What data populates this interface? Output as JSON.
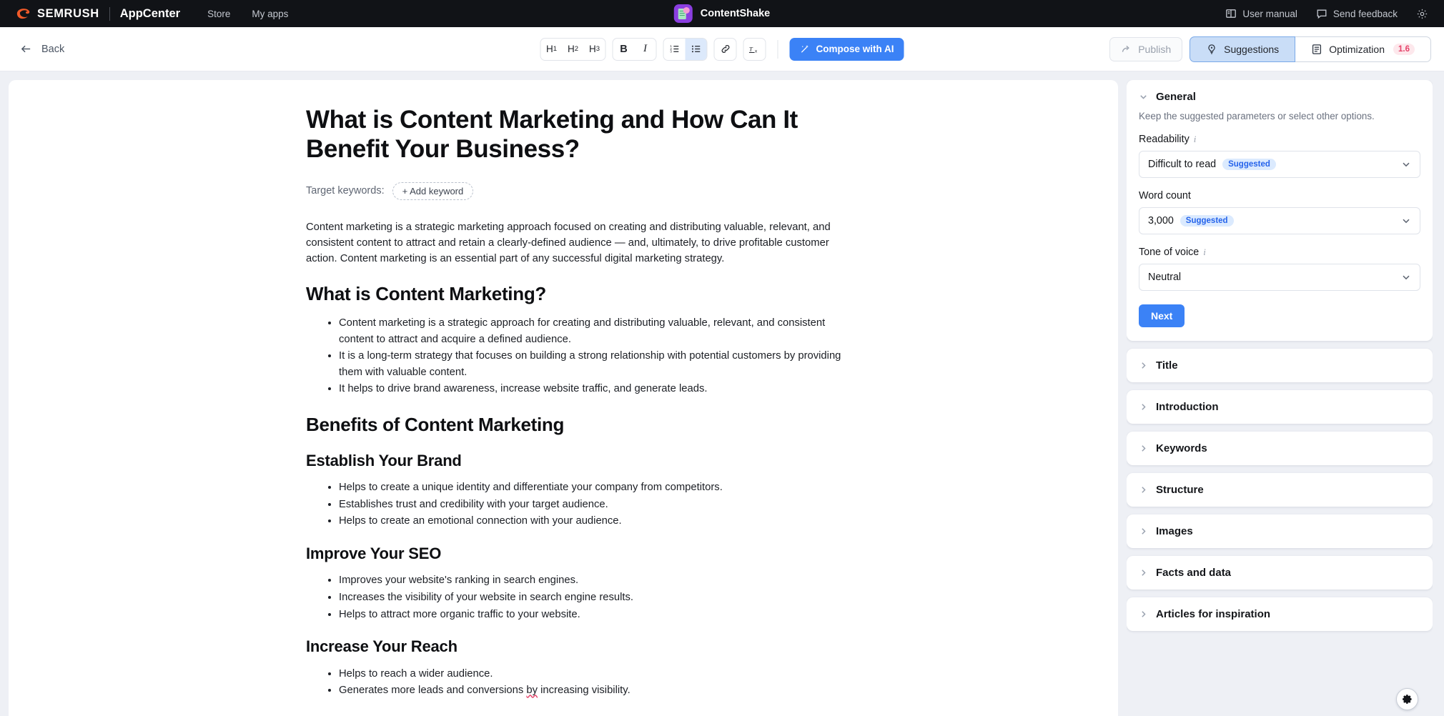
{
  "topbar": {
    "brand": "SEMRUSH",
    "product": "AppCenter",
    "nav": [
      {
        "label": "Store"
      },
      {
        "label": "My apps"
      }
    ],
    "app_name": "ContentShake",
    "app_icon": "contentshake-app-icon",
    "right": [
      {
        "label": "User manual",
        "icon": "book-icon"
      },
      {
        "label": "Send feedback",
        "icon": "chat-bubble-icon"
      }
    ],
    "settings_icon": "gear-icon",
    "colors": {
      "background": "#111317",
      "app_icon_bg": "#8b3ee0",
      "app_icon_doc": "#a8e6c0",
      "app_icon_dot": "#f49ad6"
    }
  },
  "toolbar": {
    "back_label": "Back",
    "back_icon": "arrow-left-icon",
    "format": {
      "h1": "H1",
      "h2": "H2",
      "h3": "H3",
      "bold": "B",
      "italic": "I",
      "ordered_list_icon": "ordered-list-icon",
      "unordered_list_icon": "unordered-list-icon",
      "unordered_list_active": true,
      "link_icon": "link-icon",
      "clear_format_icon": "clear-formatting-icon"
    },
    "compose_label": "Compose with AI",
    "compose_icon": "magic-wand-icon",
    "publish_label": "Publish",
    "publish_icon": "share-arrow-icon",
    "publish_disabled": true,
    "tabs": [
      {
        "label": "Suggestions",
        "icon": "lightbulb-icon",
        "active": true,
        "badge": ""
      },
      {
        "label": "Optimization",
        "icon": "document-lines-icon",
        "active": false,
        "badge": "1.6"
      }
    ],
    "colors": {
      "accent": "#3b82f6",
      "active_tab_bg": "#c9ddf7",
      "badge_bg": "#fde8ec",
      "badge_text": "#e5436a"
    }
  },
  "document": {
    "title": "What is Content Marketing and How Can It Benefit Your Business?",
    "keywords_label": "Target keywords:",
    "add_keyword_label": "+ Add keyword",
    "intro_paragraph": "Content marketing is a strategic marketing approach focused on creating and distributing valuable, relevant, and consistent content to attract and retain a clearly-defined audience — and, ultimately, to drive profitable customer action. Content marketing is an essential part of any successful digital marketing strategy.",
    "sections": [
      {
        "heading": "What is Content Marketing?",
        "level": "h2",
        "bullets": [
          "Content marketing is a strategic approach for creating and distributing valuable, relevant, and consistent content to attract and acquire a defined audience.",
          "It is a long-term strategy that focuses on building a strong relationship with potential customers by providing them with valuable content.",
          "It helps to drive brand awareness, increase website traffic, and generate leads."
        ]
      },
      {
        "heading": "Benefits of Content Marketing",
        "level": "h2",
        "bullets": []
      },
      {
        "heading": "Establish Your Brand",
        "level": "h3",
        "bullets": [
          "Helps to create a unique identity and differentiate your company from competitors.",
          "Establishes trust and credibility with your target audience.",
          "Helps to create an emotional connection with your audience."
        ]
      },
      {
        "heading": "Improve Your SEO",
        "level": "h3",
        "bullets": [
          "Improves your website's ranking in search engines.",
          "Increases the visibility of your website in search engine results.",
          "Helps to attract more organic traffic to your website."
        ]
      },
      {
        "heading": "Increase Your Reach",
        "level": "h3",
        "bullets": [
          "Helps to reach a wider audience.",
          "Generates more leads and conversions by increasing visibility."
        ]
      }
    ]
  },
  "sidebar": {
    "general": {
      "title": "General",
      "chevron": "chevron-down-icon",
      "subtitle": "Keep the suggested parameters or select other options.",
      "fields": [
        {
          "label": "Readability",
          "has_info": true,
          "value": "Difficult to read",
          "pill": "Suggested"
        },
        {
          "label": "Word count",
          "has_info": false,
          "value": "3,000",
          "pill": "Suggested"
        },
        {
          "label": "Tone of voice",
          "has_info": true,
          "value": "Neutral",
          "pill": ""
        }
      ],
      "next_label": "Next"
    },
    "collapsed_sections": [
      {
        "label": "Title"
      },
      {
        "label": "Introduction"
      },
      {
        "label": "Keywords"
      },
      {
        "label": "Structure"
      },
      {
        "label": "Images"
      },
      {
        "label": "Facts and data"
      },
      {
        "label": "Articles for inspiration"
      }
    ],
    "fab_icon": "gear-icon",
    "colors": {
      "pill_bg": "#dbeafe",
      "pill_text": "#2563eb",
      "next_bg": "#3b82f6"
    }
  }
}
